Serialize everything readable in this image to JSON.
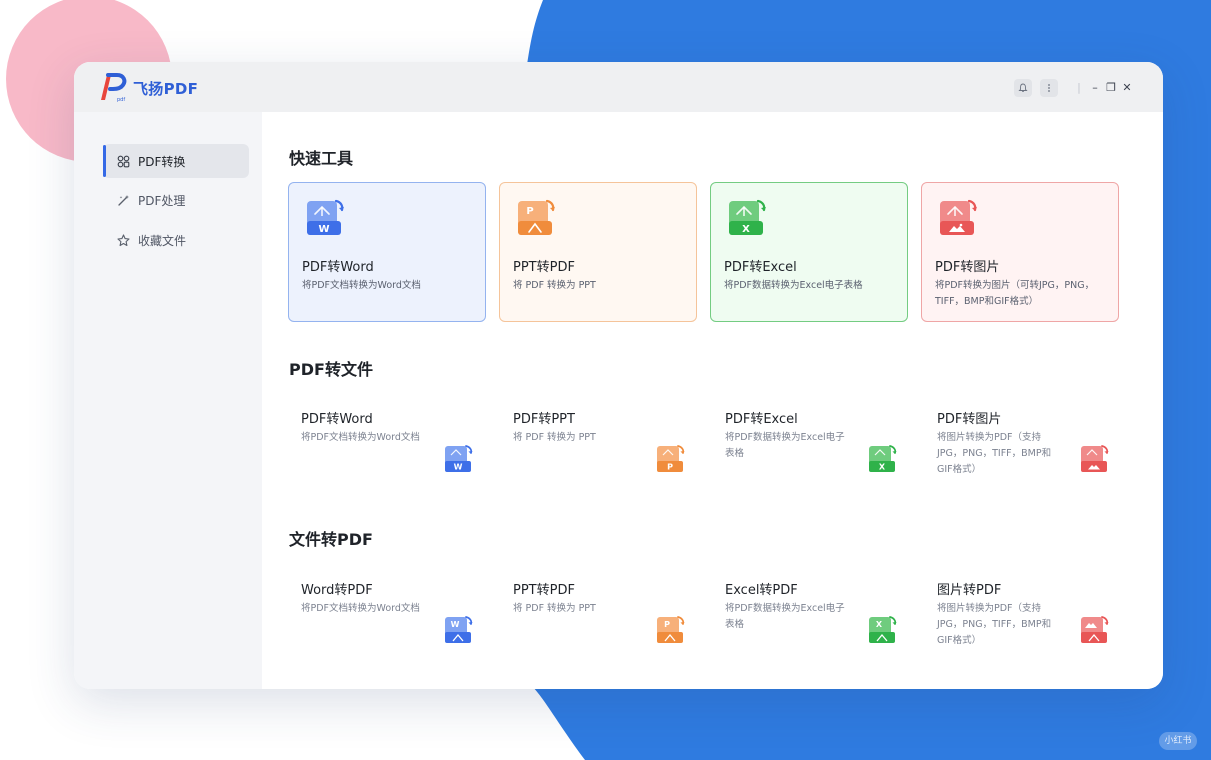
{
  "colors": {
    "accent": "#3569e6",
    "background_blue": "#2f7be0",
    "background_pink": "#f8b9c8",
    "word": "#3e6fe8",
    "ppt": "#f08c3c",
    "excel": "#2fb24a",
    "image": "#e85656"
  },
  "app": {
    "title": "飞扬PDF",
    "logo_sub": "pdf",
    "logo_icon": "p-logo-icon"
  },
  "titlebar": {
    "bell_icon": "bell-icon",
    "more_icon": "more-vertical-icon",
    "separator": "|",
    "minimize": "–",
    "restore": "❐",
    "close": "✕"
  },
  "watermark": "小红书",
  "sidebar": {
    "items": [
      {
        "label": "PDF转换",
        "icon": "convert-grid-icon",
        "active": true
      },
      {
        "label": "PDF处理",
        "icon": "magic-wand-icon",
        "active": false
      },
      {
        "label": "收藏文件",
        "icon": "star-icon",
        "active": false
      }
    ]
  },
  "main": {
    "quick": {
      "title": "快速工具",
      "cards": [
        {
          "title": "PDF转Word",
          "desc": "将PDF文档转换为Word文档",
          "icon": "pdf-to-word-icon",
          "badge": "W"
        },
        {
          "title": "PPT转PDF",
          "desc": "将 PDF 转换为 PPT",
          "icon": "ppt-to-pdf-icon",
          "badge": "P"
        },
        {
          "title": "PDF转Excel",
          "desc": "将PDF数据转换为Excel电子表格",
          "icon": "pdf-to-excel-icon",
          "badge": "X"
        },
        {
          "title": "PDF转图片",
          "desc": "将PDF转换为图片（可转JPG，PNG，TIFF，BMP和GIF格式）",
          "icon": "pdf-to-image-icon",
          "badge": ""
        }
      ]
    },
    "pdf_to_file": {
      "title": "PDF转文件",
      "tools": [
        {
          "title": "PDF转Word",
          "desc": "将PDF文档转换为Word文档",
          "icon": "pdf-to-word-icon",
          "badge": "W"
        },
        {
          "title": "PDF转PPT",
          "desc": "将 PDF 转换为 PPT",
          "icon": "pdf-to-ppt-icon",
          "badge": "P"
        },
        {
          "title": "PDF转Excel",
          "desc": "将PDF数据转换为Excel电子表格",
          "icon": "pdf-to-excel-icon",
          "badge": "X"
        },
        {
          "title": "PDF转图片",
          "desc": "将图片转换为PDF（支持JPG，PNG，TIFF，BMP和GIF格式）",
          "icon": "pdf-to-image-icon",
          "badge": ""
        }
      ]
    },
    "file_to_pdf": {
      "title": "文件转PDF",
      "tools": [
        {
          "title": "Word转PDF",
          "desc": "将PDF文档转换为Word文档",
          "icon": "word-to-pdf-icon",
          "badge": "W"
        },
        {
          "title": "PPT转PDF",
          "desc": "将 PDF 转换为 PPT",
          "icon": "ppt-to-pdf-icon",
          "badge": "P"
        },
        {
          "title": "Excel转PDF",
          "desc": "将PDF数据转换为Excel电子表格",
          "icon": "excel-to-pdf-icon",
          "badge": "X"
        },
        {
          "title": "图片转PDF",
          "desc": "将图片转换为PDF（支持JPG，PNG，TIFF，BMP和GIF格式）",
          "icon": "image-to-pdf-icon",
          "badge": ""
        }
      ]
    }
  }
}
